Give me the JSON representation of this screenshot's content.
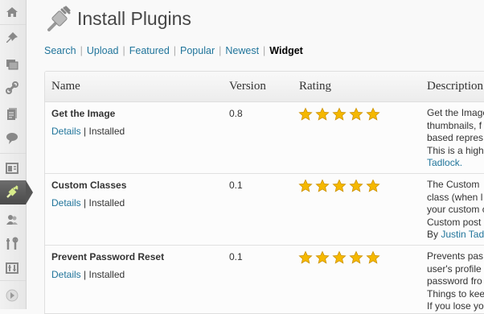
{
  "page": {
    "title": "Install Plugins"
  },
  "subnav": {
    "items": [
      {
        "label": "Search"
      },
      {
        "label": "Upload"
      },
      {
        "label": "Featured"
      },
      {
        "label": "Popular"
      },
      {
        "label": "Newest"
      }
    ],
    "current": "Widget",
    "separator": "|"
  },
  "table": {
    "headers": {
      "name": "Name",
      "version": "Version",
      "rating": "Rating",
      "description": "Description"
    },
    "rows": [
      {
        "name": "Get the Image",
        "details_label": "Details",
        "status": "| Installed",
        "version": "0.8",
        "rating_stars": 5,
        "desc_lines": [
          "Get the Image",
          "thumbnails, f",
          "based repres",
          "This is a high"
        ],
        "desc_link": "Tadlock."
      },
      {
        "name": "Custom Classes",
        "details_label": "Details",
        "status": "| Installed",
        "version": "0.1",
        "rating_stars": 5,
        "desc_lines": [
          "The Custom",
          "class (when l",
          "your custom c",
          "Custom post"
        ],
        "desc_prefix": "By ",
        "desc_link": "Justin Tad"
      },
      {
        "name": "Prevent Password Reset",
        "details_label": "Details",
        "status": "| Installed",
        "version": "0.1",
        "rating_stars": 5,
        "desc_lines": [
          "Prevents pas",
          "user's profile",
          "password fro",
          "Things to kee",
          "If you lose yo"
        ]
      }
    ]
  },
  "colors": {
    "link": "#21759b",
    "star": "#f5b800",
    "sidebar_active": "#555555"
  },
  "icons": [
    "dashboard-icon",
    "pin-icon",
    "media-icon",
    "links-icon",
    "pages-icon",
    "comments-icon",
    "appearance-icon",
    "plugins-icon",
    "users-icon",
    "tools-icon",
    "settings-icon",
    "collapse-icon"
  ]
}
